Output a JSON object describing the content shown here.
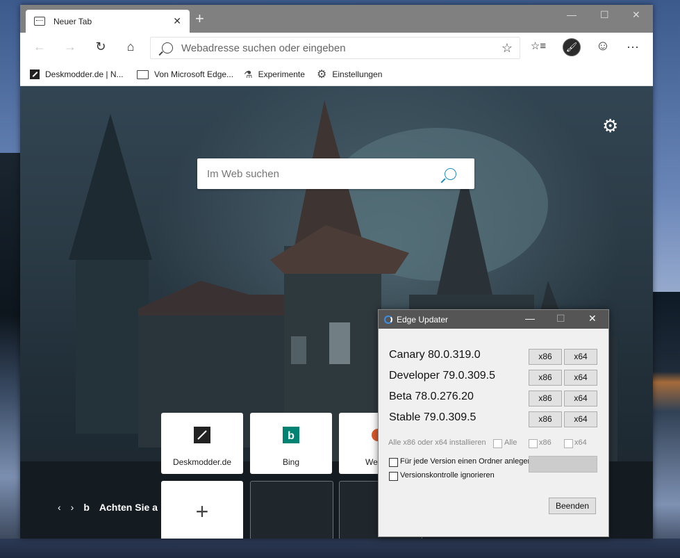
{
  "browser": {
    "tab_title": "Neuer Tab",
    "tab_close": "✕",
    "new_tab": "+",
    "window_controls": {
      "minimize": "—",
      "maximize": "☐",
      "close": "✕"
    },
    "toolbar": {
      "back": "←",
      "forward": "→",
      "refresh": "↻",
      "home": "⌂",
      "address_placeholder": "Webadresse suchen oder eingeben",
      "favorite": "☆",
      "collections": "☆≡",
      "profile": "🖌",
      "feedback": "☺",
      "more": "···"
    },
    "bookmarks": [
      {
        "label": "Deskmodder.de | N...",
        "icon": "deskmodder-icon"
      },
      {
        "label": "Von Microsoft Edge...",
        "icon": "folder-icon"
      },
      {
        "label": "Experimente",
        "icon": "flask-icon"
      },
      {
        "label": "Einstellungen",
        "icon": "gear-icon"
      }
    ]
  },
  "newtab": {
    "settings_icon": "⚙",
    "search_placeholder": "Im Web suchen",
    "tiles": [
      {
        "label": "Deskmodder.de",
        "icon": "deskmodder-icon"
      },
      {
        "label": "Bing",
        "icon": "bing-icon"
      },
      {
        "label": "We",
        "icon": "partial-icon"
      }
    ],
    "add_tile": "+",
    "news": {
      "prev": "‹",
      "next": "›",
      "bing_logo": "b",
      "text": "Achten Sie a"
    }
  },
  "updater": {
    "title": "Edge Updater",
    "controls": {
      "minimize": "—",
      "maximize": "☐",
      "close": "✕"
    },
    "versions": [
      {
        "label": "Canary 80.0.319.0",
        "x86": "x86",
        "x64": "x64"
      },
      {
        "label": "Developer 79.0.309.5",
        "x86": "x86",
        "x64": "x64"
      },
      {
        "label": "Beta 78.0.276.20",
        "x86": "x86",
        "x64": "x64"
      },
      {
        "label": "Stable 79.0.309.5",
        "x86": "x86",
        "x64": "x64"
      }
    ],
    "install_all_label": "Alle x86 oder x64 installieren",
    "opt_all": "Alle",
    "opt_x86": "x86",
    "opt_x64": "x64",
    "folder_option": "Für jede Version einen Ordner anlegen",
    "ignore_version_check": "Versionskontrolle ignorieren",
    "quit_button": "Beenden"
  }
}
